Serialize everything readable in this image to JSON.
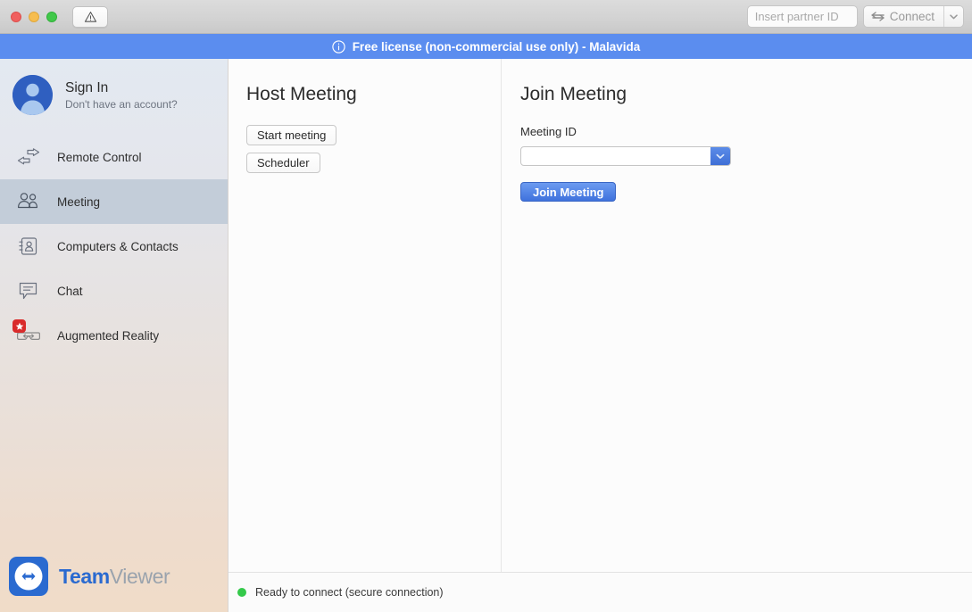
{
  "titlebar": {
    "warning_icon": "warning-triangle-icon",
    "partner_id_value": "",
    "partner_id_placeholder": "Insert partner ID",
    "connect_label": "Connect",
    "connect_icon": "bidirectional-arrow-icon",
    "connect_caret_icon": "chevron-down-icon",
    "window_controls": [
      "close",
      "minimize",
      "maximize"
    ]
  },
  "banner": {
    "info_icon": "info-circle-icon",
    "text": "Free license (non-commercial use only) - Malavida",
    "color": "#5b8def"
  },
  "sidebar": {
    "account": {
      "title": "Sign In",
      "subtitle": "Don't have an account?",
      "avatar_icon": "user-avatar-icon"
    },
    "items": [
      {
        "label": "Remote Control",
        "icon": "two-arrows-icon",
        "active": false
      },
      {
        "label": "Meeting",
        "icon": "people-icon",
        "active": true
      },
      {
        "label": "Computers & Contacts",
        "icon": "address-book-icon",
        "active": false
      },
      {
        "label": "Chat",
        "icon": "speech-bubble-icon",
        "active": false
      },
      {
        "label": "Augmented Reality",
        "icon": "ar-glasses-icon",
        "active": false,
        "badge": "star"
      }
    ],
    "brand": {
      "name_bold": "Team",
      "name_light": "Viewer",
      "logo_icon": "teamviewer-logo-icon"
    }
  },
  "main": {
    "host": {
      "title": "Host Meeting",
      "start_meeting_label": "Start meeting",
      "scheduler_label": "Scheduler"
    },
    "join": {
      "title": "Join Meeting",
      "meeting_id_label": "Meeting ID",
      "meeting_id_value": "",
      "meeting_id_placeholder": "",
      "dropdown_icon": "chevron-down-icon",
      "join_button_label": "Join Meeting"
    }
  },
  "statusbar": {
    "text": "Ready to connect (secure connection)",
    "indicator_color": "#34c94a"
  }
}
